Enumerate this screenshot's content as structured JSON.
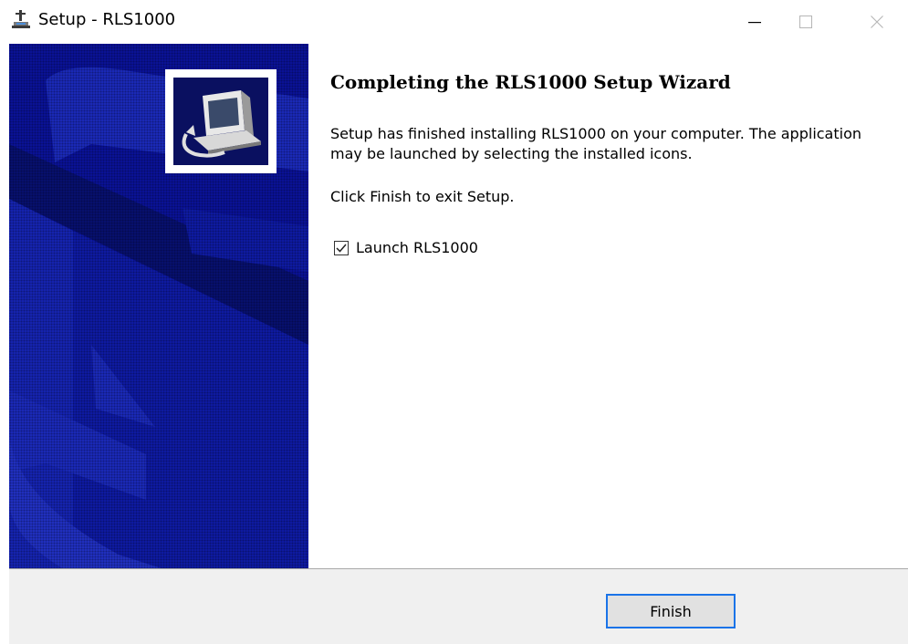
{
  "window": {
    "title": "Setup - RLS1000",
    "controls": [
      "minimize",
      "maximize",
      "close"
    ]
  },
  "icons": {
    "app": "installer-computer-icon",
    "banner_logo": "computer-setup-icon"
  },
  "wizard": {
    "heading": "Completing the RLS1000 Setup Wizard",
    "description": "Setup has finished installing RLS1000 on your computer. The application may be launched by selecting the installed icons.",
    "hint": "Click Finish to exit Setup.",
    "launch_checkbox": {
      "label": "Launch RLS1000",
      "checked": true
    }
  },
  "footer": {
    "finish_label": "Finish"
  },
  "colors": {
    "banner": "#0a1296",
    "accent_border": "#1a73e8"
  }
}
